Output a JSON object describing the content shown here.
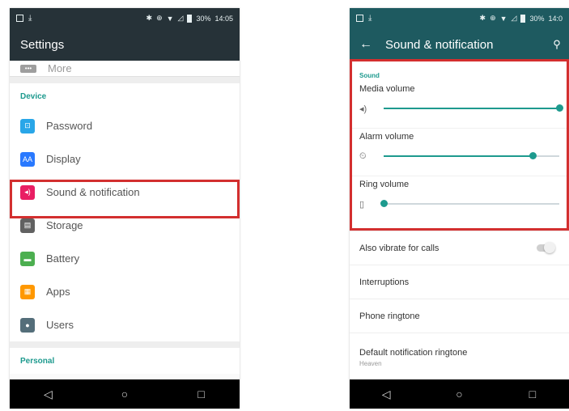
{
  "left_phone": {
    "status_time": "14:05",
    "status_battery": "30%",
    "title": "Settings",
    "more_label": "More",
    "device_section": "Device",
    "items": [
      {
        "label": "Password",
        "icon": "lock-icon",
        "color": "#29a6e8",
        "glyph": "⊡"
      },
      {
        "label": "Display",
        "icon": "display-icon",
        "color": "#2979ff",
        "glyph": "AA"
      },
      {
        "label": "Sound & notification",
        "icon": "speaker-icon",
        "color": "#e91e63",
        "glyph": "◂)"
      },
      {
        "label": "Storage",
        "icon": "storage-icon",
        "color": "#616161",
        "glyph": "▤"
      },
      {
        "label": "Battery",
        "icon": "battery-icon",
        "color": "#4caf50",
        "glyph": "▬"
      },
      {
        "label": "Apps",
        "icon": "apps-icon",
        "color": "#ff9800",
        "glyph": "▦"
      },
      {
        "label": "Users",
        "icon": "users-icon",
        "color": "#546e7a",
        "glyph": "●"
      }
    ],
    "personal_section": "Personal"
  },
  "right_phone": {
    "status_time": "14:0",
    "status_battery": "30%",
    "title": "Sound & notification",
    "sound_section": "Sound",
    "volumes": [
      {
        "label": "Media volume",
        "icon": "speaker-icon",
        "glyph": "◂)",
        "level": 1.0
      },
      {
        "label": "Alarm volume",
        "icon": "alarm-icon",
        "glyph": "⏲",
        "level": 0.85
      },
      {
        "label": "Ring volume",
        "icon": "vibrate-icon",
        "glyph": "▯",
        "level": 0.0
      }
    ],
    "vibrate_label": "Also vibrate for calls",
    "vibrate_on": false,
    "interruptions_label": "Interruptions",
    "phone_ringtone_label": "Phone ringtone",
    "default_ringtone_label": "Default notification ringtone",
    "default_ringtone_value": "Heaven"
  },
  "colors": {
    "accent": "#1d9a8e",
    "highlight": "#d32f2f",
    "left_bar": "#263238",
    "right_bar": "#1e5a60"
  }
}
